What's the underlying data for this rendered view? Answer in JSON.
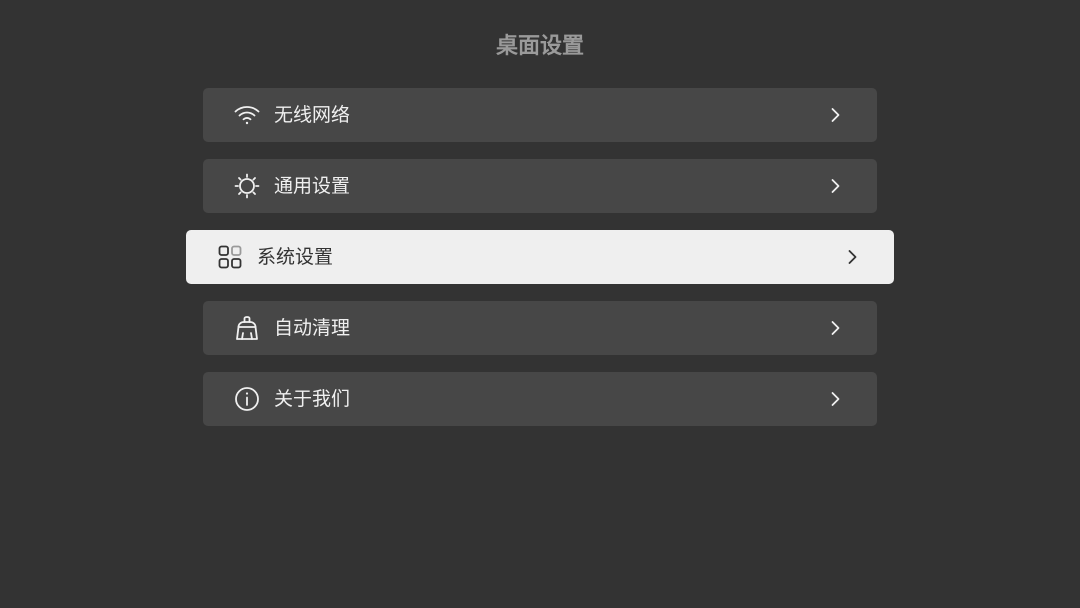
{
  "header": {
    "title": "桌面设置"
  },
  "menu": {
    "items": [
      {
        "label": "无线网络",
        "icon": "wifi-icon",
        "selected": false
      },
      {
        "label": "通用设置",
        "icon": "sun-icon",
        "selected": false
      },
      {
        "label": "系统设置",
        "icon": "apps-grid-icon",
        "selected": true
      },
      {
        "label": "自动清理",
        "icon": "broom-icon",
        "selected": false
      },
      {
        "label": "关于我们",
        "icon": "info-icon",
        "selected": false
      }
    ]
  },
  "colors": {
    "background": "#333333",
    "item_background": "#474747",
    "selected_background": "#efefef",
    "title_text": "#9a9a9a",
    "item_text": "#f0f0f0",
    "selected_text": "#333333"
  }
}
